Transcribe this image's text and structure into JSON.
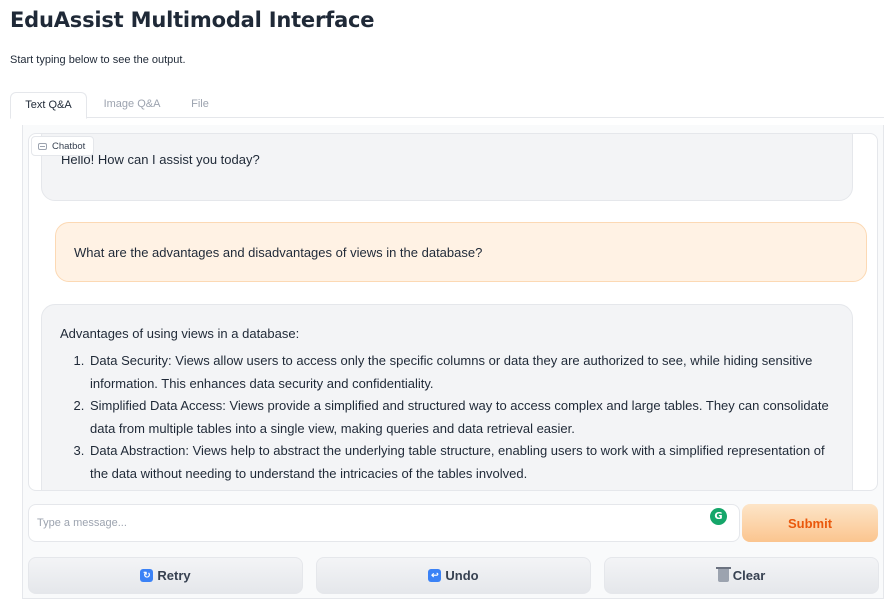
{
  "app": {
    "title": "EduAssist Multimodal Interface",
    "subtitle": "Start typing below to see the output."
  },
  "tabs": [
    {
      "label": "Text Q&A",
      "active": true
    },
    {
      "label": "Image Q&A",
      "active": false
    },
    {
      "label": "File",
      "active": false
    }
  ],
  "chatbot": {
    "label": "Chatbot",
    "label_icon": "chat-icon",
    "messages": [
      {
        "role": "bot",
        "text": "Hello! How can I assist you today?"
      },
      {
        "role": "user",
        "text": "What are the advantages and disadvantages of views in the database?"
      },
      {
        "role": "bot",
        "intro": "Advantages of using views in a database:",
        "items": [
          "Data Security: Views allow users to access only the specific columns or data they are authorized to see, while hiding sensitive information. This enhances data security and confidentiality.",
          "Simplified Data Access: Views provide a simplified and structured way to access complex and large tables. They can consolidate data from multiple tables into a single view, making queries and data retrieval easier.",
          "Data Abstraction: Views help to abstract the underlying table structure, enabling users to work with a simplified representation of the data without needing to understand the intricacies of the tables involved."
        ]
      }
    ]
  },
  "input": {
    "placeholder": "Type a message...",
    "value": "",
    "extension_icon": "grammarly-icon",
    "extension_letter": "G",
    "submit_label": "Submit"
  },
  "actions": {
    "retry_label": "Retry",
    "retry_icon": "retry-icon",
    "undo_label": "Undo",
    "undo_icon": "undo-icon",
    "clear_label": "Clear",
    "clear_icon": "trash-icon"
  },
  "colors": {
    "accent": "#ea580c",
    "user_bubble": "#fff2e4",
    "bot_bubble": "#f3f4f6",
    "grammarly": "#15a66a"
  }
}
